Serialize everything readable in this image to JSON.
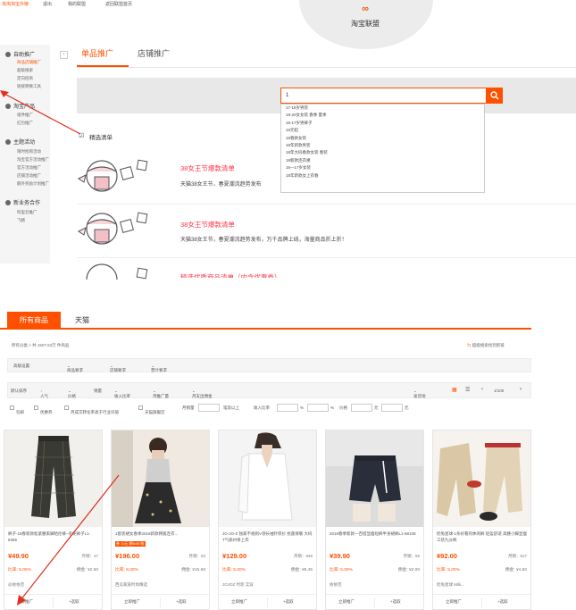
{
  "topbar": {
    "site": "淘淘淘宝外链",
    "logout": "退出",
    "my_union": "我的联盟",
    "back_home": "返回联盟首页"
  },
  "logo": {
    "text": "淘宝联盟"
  },
  "sidebar": {
    "groups": [
      {
        "title": "自助推广",
        "items": [
          "商品店铺推广",
          "超级搜索",
          "定向招商",
          "链接转换工具"
        ]
      },
      {
        "title": "淘宝产品",
        "items": [
          "组件推广",
          "红包推广"
        ]
      },
      {
        "title": "主题活动",
        "items": [
          "限时抢购活动",
          "淘宝官方活动推广",
          "官方活动推广",
          "店铺活动推广",
          "额外奖励计划推广"
        ]
      },
      {
        "title": "新业务合作",
        "items": [
          "阿里云推广",
          "飞猪"
        ]
      }
    ]
  },
  "main_tabs": {
    "active": "单品推广",
    "other": "店铺推广"
  },
  "search": {
    "value": "1",
    "suggestions": [
      "17-18岁男装",
      "18-20女女装 春季 夏季",
      "16-17岁男裤子",
      "16元起",
      "18春款女装",
      "18年新款男装",
      "18年大码春款女装 春装",
      "18新款连衣裙",
      "16—17岁女装",
      "18年新款女上衣春"
    ]
  },
  "featured": {
    "title": "精选清单"
  },
  "promos": [
    {
      "title": "38女王节爆款清单",
      "sub": "天猫38女王节，春夏潮流趋势发布"
    },
    {
      "title": "38女王节爆款清单",
      "sub": "天猫38女王节，春夏潮流趋势发布，万千品牌上线，海量商品折上折！"
    },
    {
      "title": "精选优质商品清单（内含优惠券）",
      "sub": ""
    }
  ],
  "product_tabs": {
    "active": "所有商品",
    "other": "天猫"
  },
  "breadcrumb": "所有分类 > 共 1507.63万 件商品",
  "advanced_search_link": "超级搜索找到新链",
  "filters": {
    "label": "高级设置:",
    "items": [
      "商品要求",
      "店铺要求",
      "营计要求"
    ]
  },
  "sort": {
    "items": [
      "默认排序",
      "人气",
      "价格",
      "销量",
      "收入比率",
      "月推广量",
      "月支出佣金"
    ],
    "active_index": 1,
    "ship_from": "发货地",
    "page": "1/100"
  },
  "options": {
    "checks": [
      "包邮",
      "优惠券",
      "月成交转化率高于行业均值",
      "天猫旗舰店"
    ],
    "fields": [
      "月销量",
      "笔及以上",
      "收入比率",
      "%",
      "%",
      "价格",
      "元",
      "元"
    ]
  },
  "products": [
    {
      "title": "裤子-18春新款松紧腰束脚哈伦裤~毛呢裤子L1-6355",
      "price": "¥49.90",
      "sales": "月销：47",
      "rate": "比率: 5.00%",
      "comm": "佣金: ¥2.50",
      "shop": "@依依范",
      "promote": "立即推广",
      "pick": "+选取",
      "tag": ""
    },
    {
      "title": "1套装裙女春季2018新款韩版连衣...",
      "price": "¥196.00",
      "sales": "月销：63",
      "rate": "比率: 8.00%",
      "comm": "佣金: ¥15.68",
      "shop": "西瓜家族时尚精选",
      "promote": "立即推广",
      "pick": "+选取",
      "tag": "券 10元 剩6490张"
    },
    {
      "title": "JO-JO-Z 独家不规则V领长袖针织衫 抗菌保暖 大码T气质衬褂上衣",
      "price": "¥129.00",
      "sales": "月销：946",
      "rate": "比率: 5.00%",
      "comm": "佣金: ¥6.45",
      "shop": "JOJOZ 时装 实穿",
      "promote": "立即推广",
      "pick": "+选取",
      "tag": ""
    },
    {
      "title": "2018春季新款一百搭显瘦短裤半身裙裤L1-68108",
      "price": "¥39.90",
      "sales": "月销：65",
      "rate": "比率: 5.00%",
      "comm": "佣金: ¥2.00",
      "shop": "依依范",
      "promote": "立即推广",
      "pick": "+选取",
      "tag": ""
    },
    {
      "title": "奶兔星球-1条好看的休闲裤 轻盈舒适 高腰小脚显瘦工装九分裤",
      "price": "¥92.00",
      "sales": "月销：517",
      "rate": "比率: 5.00%",
      "comm": "佣金: ¥4.60",
      "shop": "奶兔星球 Milk...",
      "promote": "立即推广",
      "pick": "+选取",
      "tag": ""
    }
  ],
  "colors": {
    "accent": "#ff5000",
    "promo": "#ff3344"
  }
}
